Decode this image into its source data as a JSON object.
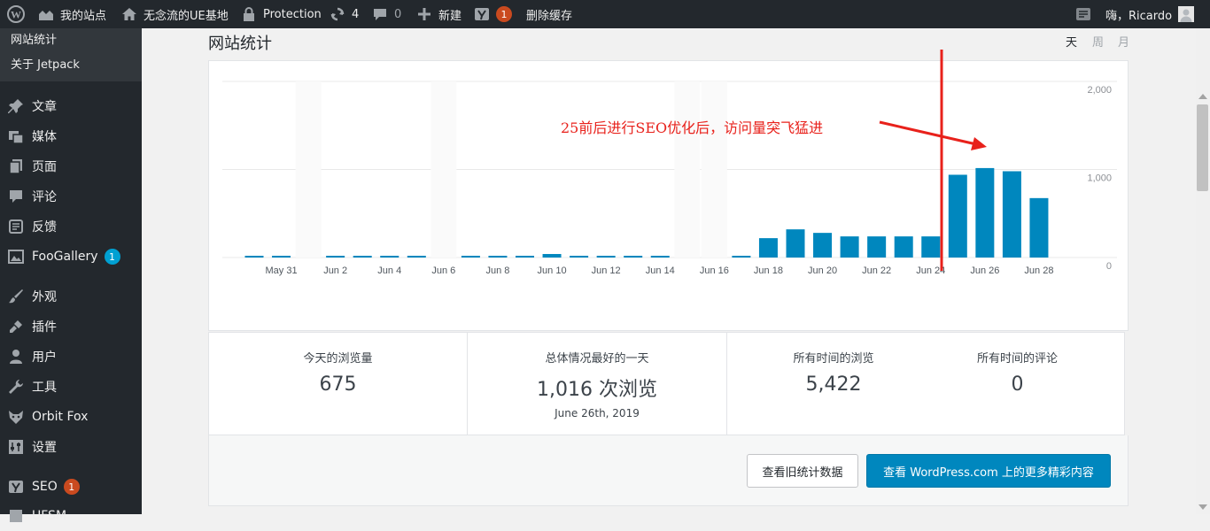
{
  "admin_bar": {
    "site_name": "我的站点",
    "home_label": "无念流的UE基地",
    "protection_label": "Protection",
    "updates_count": "4",
    "comments_count": "0",
    "new_label": "新建",
    "yoast_badge": "1",
    "purge_cache_label": "删除缓存",
    "greeting": "嗨，Ricardo"
  },
  "sidebar": {
    "submenu": [
      "网站统计",
      "关于 Jetpack"
    ],
    "items": [
      {
        "label": "文章",
        "icon": "pin-icon"
      },
      {
        "label": "媒体",
        "icon": "media-icon"
      },
      {
        "label": "页面",
        "icon": "page-icon"
      },
      {
        "label": "评论",
        "icon": "comment-icon"
      },
      {
        "label": "反馈",
        "icon": "feedback-icon"
      },
      {
        "label": "FooGallery",
        "icon": "gallery-icon",
        "badge": "1"
      },
      {
        "label": "外观",
        "icon": "brush-icon"
      },
      {
        "label": "插件",
        "icon": "plugin-icon"
      },
      {
        "label": "用户",
        "icon": "user-icon"
      },
      {
        "label": "工具",
        "icon": "wrench-icon"
      },
      {
        "label": "Orbit Fox",
        "icon": "fox-icon"
      },
      {
        "label": "设置",
        "icon": "settings-icon"
      },
      {
        "label": "SEO",
        "icon": "yoast-icon",
        "badge": "1"
      },
      {
        "label": "UFSM",
        "icon": "ufsm-icon"
      }
    ]
  },
  "main": {
    "title": "网站统计",
    "periods": [
      "天",
      "周",
      "月"
    ],
    "annotation": "25前后进行SEO优化后，访问量突飞猛进",
    "stats": [
      {
        "label": "今天的浏览量",
        "value": "675"
      },
      {
        "label": "总体情况最好的一天",
        "value": "1,016 次浏览",
        "sub": "June 26th, 2019"
      },
      {
        "label": "所有时间的浏览",
        "value": "5,422"
      },
      {
        "label": "所有时间的评论",
        "value": "0"
      }
    ],
    "buttons": {
      "old_stats": "查看旧统计数据",
      "more": "查看 WordPress.com 上的更多精彩内容"
    }
  },
  "chart_data": {
    "type": "bar",
    "ylim": [
      0,
      2000
    ],
    "yticks": [
      "2,000",
      "1,000",
      "0"
    ],
    "tick_labels": [
      "May 31",
      "Jun 2",
      "Jun 4",
      "Jun 6",
      "Jun 8",
      "Jun 10",
      "Jun 12",
      "Jun 14",
      "Jun 16",
      "Jun 18",
      "Jun 20",
      "Jun 22",
      "Jun 24",
      "Jun 26",
      "Jun 28"
    ],
    "categories": [
      "May 30",
      "May 31",
      "Jun 1",
      "Jun 2",
      "Jun 3",
      "Jun 4",
      "Jun 5",
      "Jun 6",
      "Jun 7",
      "Jun 8",
      "Jun 9",
      "Jun 10",
      "Jun 11",
      "Jun 12",
      "Jun 13",
      "Jun 14",
      "Jun 15",
      "Jun 16",
      "Jun 17",
      "Jun 18",
      "Jun 19",
      "Jun 20",
      "Jun 21",
      "Jun 22",
      "Jun 23",
      "Jun 24",
      "Jun 25",
      "Jun 26",
      "Jun 27",
      "Jun 28"
    ],
    "values": [
      20,
      20,
      0,
      20,
      20,
      20,
      20,
      0,
      20,
      20,
      20,
      40,
      20,
      20,
      20,
      20,
      0,
      0,
      20,
      220,
      320,
      280,
      240,
      240,
      240,
      240,
      940,
      1016,
      980,
      675
    ],
    "bar_color": "#0087be",
    "grid": true
  }
}
